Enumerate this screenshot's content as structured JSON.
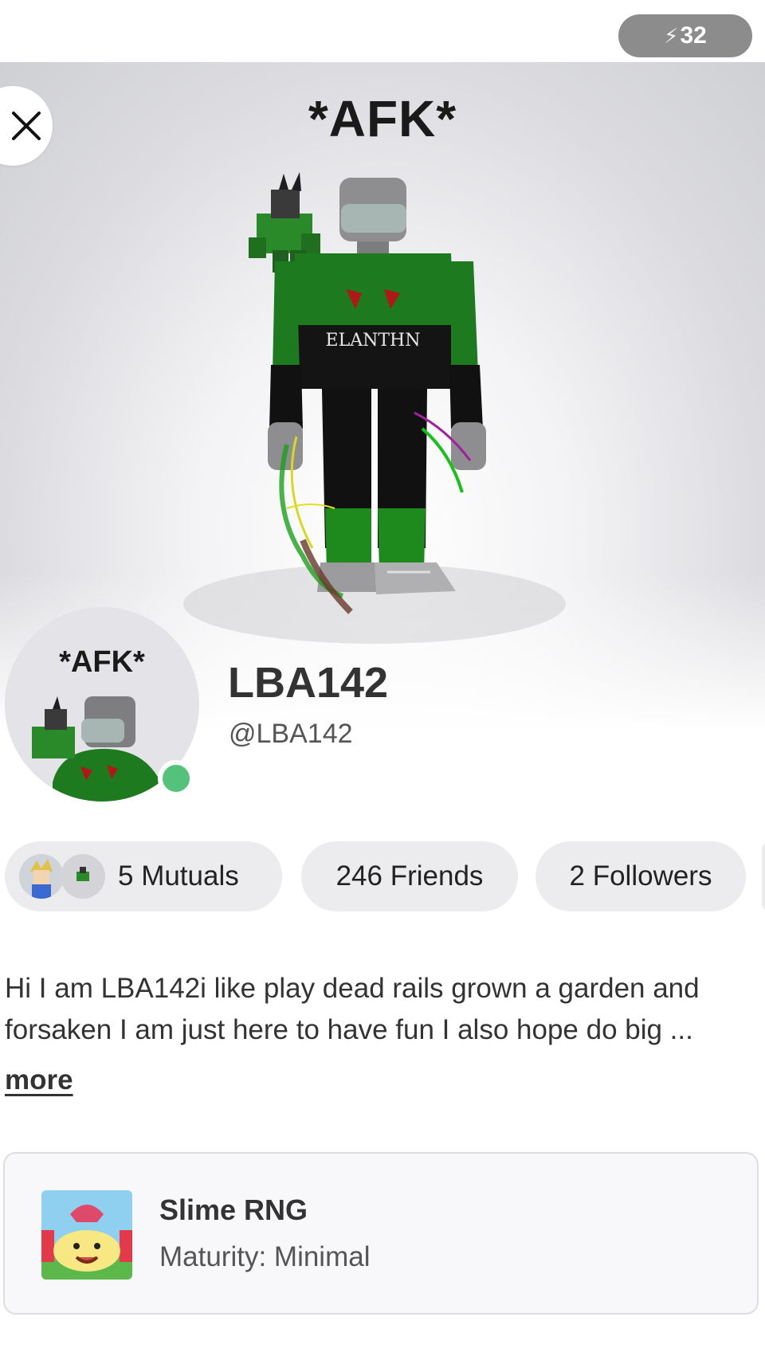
{
  "status": {
    "badge_text": "32",
    "icon": "lightning-bolt-icon"
  },
  "stage": {
    "avatar_overhead_text": "*AFK*",
    "close_icon": "close-icon"
  },
  "profile": {
    "picture_caption": "*AFK*",
    "display_name": "LBA142",
    "username": "@LBA142",
    "online": true,
    "online_color": "#55c27c"
  },
  "stats": {
    "mutuals": "5 Mutuals",
    "friends": "246 Friends",
    "followers": "2 Followers"
  },
  "bio": {
    "text": "Hi I am LBA142i like play dead rails grown a garden and forsaken I am just here to have fun I also hope do big ...",
    "more_label": "more"
  },
  "experience": {
    "title": "Slime RNG",
    "maturity": "Maturity: Minimal"
  }
}
